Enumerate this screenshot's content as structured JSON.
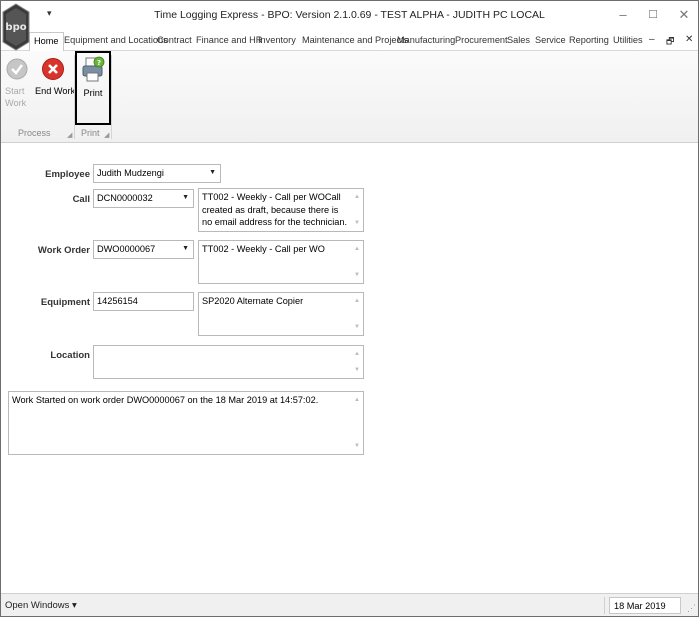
{
  "window": {
    "title": "Time Logging Express - BPO: Version 2.1.0.69 - TEST ALPHA - JUDITH PC LOCAL",
    "logo_text": "bpo",
    "qat_label": "▾",
    "minimize": "–",
    "maximize": "☐",
    "close": "✕"
  },
  "ribbon_tabs": [
    "Home",
    "Equipment and Locations",
    "Contract",
    "Finance and HR",
    "Inventory",
    "Maintenance and Projects",
    "Manufacturing",
    "Procurement",
    "Sales",
    "Service",
    "Reporting",
    "Utilities"
  ],
  "mdi": {
    "minimize": "–",
    "restore": "🗗",
    "close": "✕"
  },
  "ribbon": {
    "start_work": "Start Work",
    "end_work": "End Work",
    "print": "Print",
    "group_process": "Process",
    "group_print": "Print"
  },
  "form": {
    "employee_label": "Employee",
    "employee_value": "Judith Mudzengi",
    "call_label": "Call",
    "call_value": "DCN0000032",
    "call_description": "TT002 - Weekly - Call per WOCall created as draft, because there is no email address for the technician.",
    "work_order_label": "Work Order",
    "work_order_value": "DWO0000067",
    "work_order_description": "TT002 - Weekly - Call per WO",
    "equipment_label": "Equipment",
    "equipment_value": "14256154",
    "equipment_description": "SP2020 Alternate Copier",
    "location_label": "Location",
    "location_value": "",
    "log_text": "Work Started on work order DWO0000067 on the 18 Mar 2019 at 14:57:02."
  },
  "statusbar": {
    "open_windows": "Open Windows ▾",
    "date": "18 Mar 2019"
  },
  "colors": {
    "accent": "#1e6fc4",
    "end_work_red": "#d9342b",
    "start_work_gray": "#b5b5b5"
  }
}
